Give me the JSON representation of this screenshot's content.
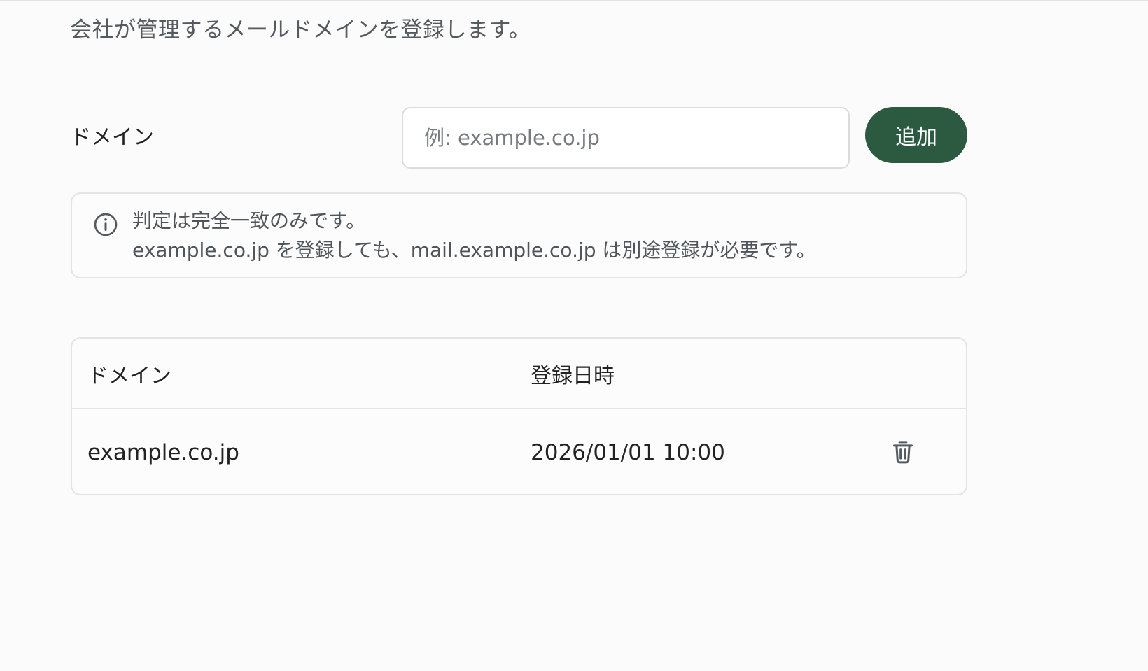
{
  "page": {
    "description": "会社が管理するメールドメインを登録します。"
  },
  "form": {
    "label": "ドメイン",
    "input_value": "",
    "input_placeholder": "例: example.co.jp",
    "add_label": "追加"
  },
  "info": {
    "icon": "info-circle-icon",
    "line1": "判定は完全一致のみです。",
    "line2": "example.co.jp を登録しても、mail.example.co.jp は別途登録が必要です。"
  },
  "table": {
    "headers": {
      "domain": "ドメイン",
      "registered_at": "登録日時"
    },
    "rows": [
      {
        "domain": "example.co.jp",
        "registered_at": "2026/01/01 10:00",
        "action_icon": "trash-icon"
      }
    ]
  },
  "colors": {
    "accent": "#2c5a41",
    "text_primary": "#222222",
    "text_secondary": "#555a5f",
    "border": "#e4e4e4",
    "background": "#fbfbfb"
  }
}
